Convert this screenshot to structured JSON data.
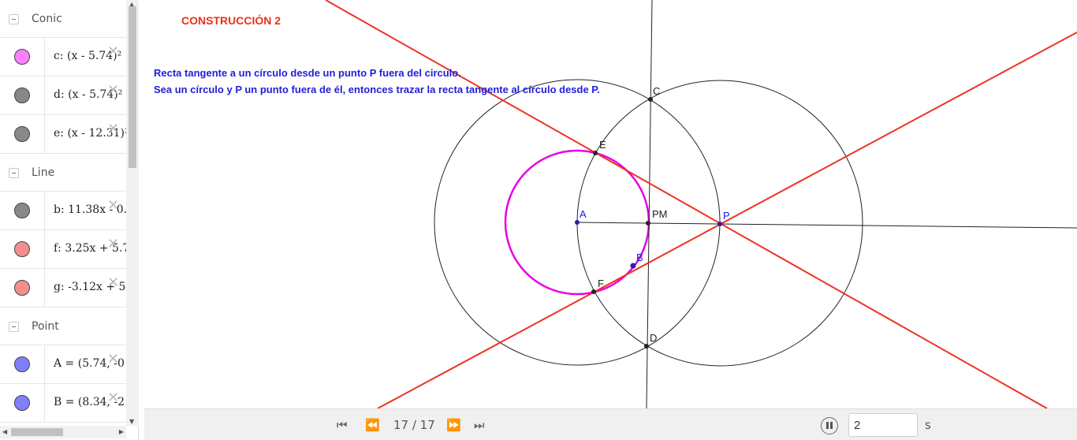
{
  "colors": {
    "pink": "#ff80ff",
    "gray": "#888888",
    "red": "#f48f8f",
    "blue": "#8080ff",
    "construction_red": "#e8321e",
    "text_blue": "#2020dd"
  },
  "algebra": {
    "groups": [
      {
        "label": "Conic",
        "items": [
          {
            "expr": "c: (x - 5.74)²",
            "color": "#ff80ff"
          },
          {
            "expr": "d: (x - 5.74)²",
            "color": "#888888"
          },
          {
            "expr": "e: (x - 12.31)²",
            "color": "#888888"
          }
        ]
      },
      {
        "label": "Line",
        "items": [
          {
            "expr": "b: 11.38x - 0.",
            "color": "#888888"
          },
          {
            "expr": "f: 3.25x + 5.7",
            "color": "#f48f8f"
          },
          {
            "expr": "g: -3.12x + 5.",
            "color": "#f48f8f"
          }
        ]
      },
      {
        "label": "Point",
        "items": [
          {
            "expr": "A = (5.74, -0",
            "color": "#8080ff"
          },
          {
            "expr": "B = (8.34, -2",
            "color": "#8080ff"
          }
        ]
      }
    ]
  },
  "graphics": {
    "title": "CONSTRUCCIÓN 2",
    "description_line1": "Recta tangente a un círculo desde un punto P fuera del circulo.",
    "description_line2": "Sea un círculo y P un punto fuera de él, entonces trazar la recta tangente al círculo desde P.",
    "point_labels": {
      "A": "A",
      "B": "B",
      "C": "C",
      "D": "D",
      "E": "E",
      "F": "F",
      "P": "P",
      "PM": "PM"
    }
  },
  "playbar": {
    "frame_counter": "17 / 17",
    "speed_value": "2",
    "speed_unit": "s"
  }
}
